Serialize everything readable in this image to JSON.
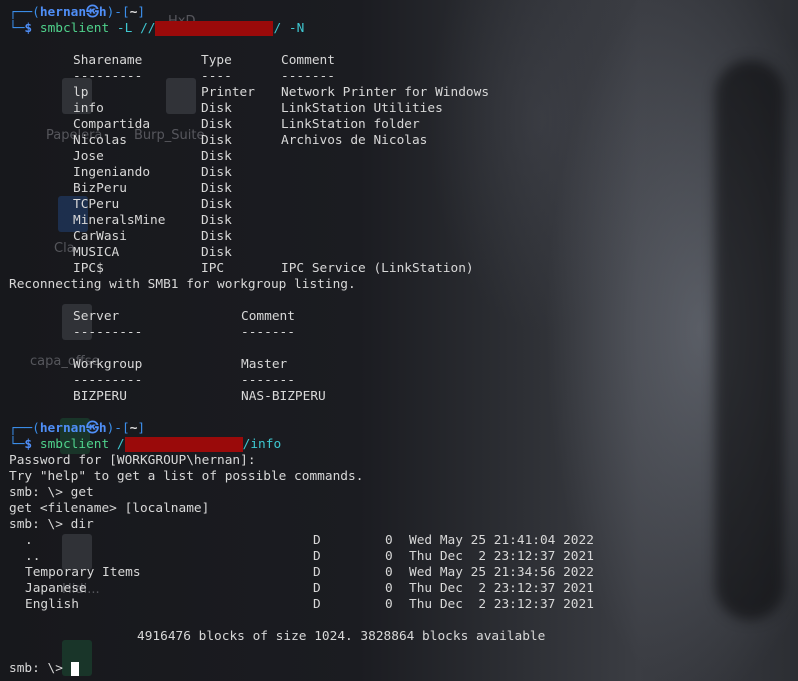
{
  "desktop_icons": [
    "HxD",
    "Papelera",
    "Burp_Suite",
    "Cla",
    "capa_offse",
    "Hidi..."
  ],
  "prompt": {
    "user": "hernan",
    "symbol": "㉿",
    "host": "h",
    "dir": "~"
  },
  "cmd1": {
    "program": "smbclient",
    "flag": "-L",
    "slashes": "//",
    "tail": "/",
    "flag2": "-N"
  },
  "shares": {
    "headers": [
      "Sharename",
      "Type",
      "Comment"
    ],
    "rows": [
      {
        "name": "lp",
        "type": "Printer",
        "comment": "Network Printer for Windows"
      },
      {
        "name": "info",
        "type": "Disk",
        "comment": "LinkStation Utilities"
      },
      {
        "name": "Compartida",
        "type": "Disk",
        "comment": "LinkStation folder"
      },
      {
        "name": "Nicolas",
        "type": "Disk",
        "comment": "Archivos de Nicolas"
      },
      {
        "name": "Jose",
        "type": "Disk",
        "comment": ""
      },
      {
        "name": "Ingeniando",
        "type": "Disk",
        "comment": ""
      },
      {
        "name": "BizPeru",
        "type": "Disk",
        "comment": ""
      },
      {
        "name": "TCPeru",
        "type": "Disk",
        "comment": ""
      },
      {
        "name": "MineralsMine",
        "type": "Disk",
        "comment": ""
      },
      {
        "name": "CarWasi",
        "type": "Disk",
        "comment": ""
      },
      {
        "name": "MUSICA",
        "type": "Disk",
        "comment": ""
      },
      {
        "name": "IPC$",
        "type": "IPC",
        "comment": "IPC Service (LinkStation)"
      }
    ]
  },
  "reconnect": "Reconnecting with SMB1 for workgroup listing.",
  "server_table": {
    "h1": "Server",
    "h2": "Comment"
  },
  "workgroup_table": {
    "h1": "Workgroup",
    "h2": "Master",
    "v1": "BIZPERU",
    "v2": "NAS-BIZPERU"
  },
  "cmd2": {
    "program": "smbclient",
    "lead": "/",
    "tail": "/info"
  },
  "session": {
    "password": "Password for [WORKGROUP\\hernan]:",
    "help": "Try \"help\" to get a list of possible commands.",
    "get_cmd": "smb: \\> get",
    "get_usage": "get <filename> [localname]",
    "dir_cmd": "smb: \\> dir",
    "files": [
      {
        "name": ".",
        "attr": "D",
        "size": "0",
        "date": "Wed May 25 21:41:04 2022"
      },
      {
        "name": "..",
        "attr": "D",
        "size": "0",
        "date": "Thu Dec  2 23:12:37 2021"
      },
      {
        "name": "Temporary Items",
        "attr": "D",
        "size": "0",
        "date": "Wed May 25 21:34:56 2022"
      },
      {
        "name": "Japanese",
        "attr": "D",
        "size": "0",
        "date": "Thu Dec  2 23:12:37 2021"
      },
      {
        "name": "English",
        "attr": "D",
        "size": "0",
        "date": "Thu Dec  2 23:12:37 2021"
      }
    ],
    "blocks": "4916476 blocks of size 1024. 3828864 blocks available",
    "final_prompt": "smb: \\>"
  }
}
